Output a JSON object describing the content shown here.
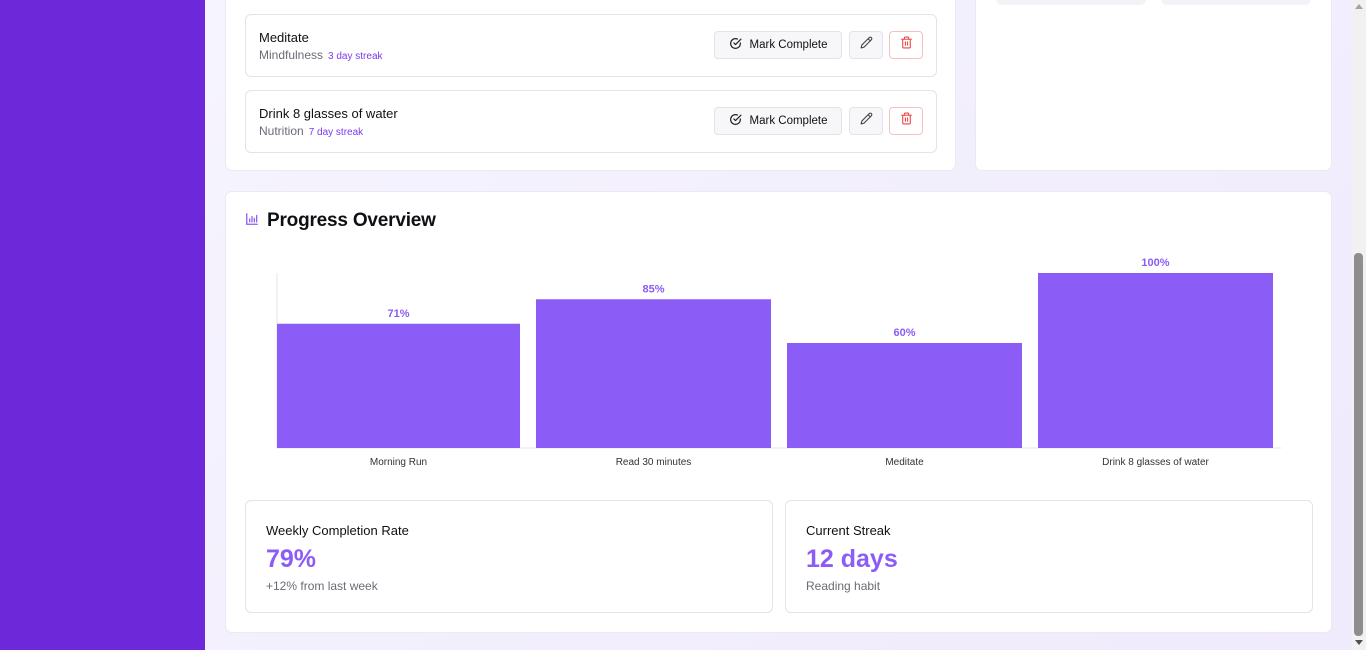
{
  "habits": [
    {
      "name": "Meditate",
      "category": "Mindfulness",
      "streak": "3 day streak"
    },
    {
      "name": "Drink 8 glasses of water",
      "category": "Nutrition",
      "streak": "7 day streak"
    }
  ],
  "actions": {
    "complete_label": "Mark Complete"
  },
  "progress": {
    "title": "Progress Overview"
  },
  "chart_data": {
    "type": "bar",
    "categories": [
      "Morning Run",
      "Read 30 minutes",
      "Meditate",
      "Drink 8 glasses of water"
    ],
    "values": [
      71,
      85,
      60,
      100
    ],
    "value_labels": [
      "71%",
      "85%",
      "60%",
      "100%"
    ],
    "ylim": [
      0,
      100
    ],
    "bar_color": "#8b5cf6",
    "grid": false
  },
  "stats": {
    "weekly": {
      "label": "Weekly Completion Rate",
      "value": "79%",
      "sub": "+12% from last week"
    },
    "streak": {
      "label": "Current Streak",
      "value": "12 days",
      "sub": "Reading habit"
    }
  },
  "colors": {
    "accent": "#8b5cf6",
    "sidebar": "#6d28d9",
    "danger": "#ef4444"
  }
}
